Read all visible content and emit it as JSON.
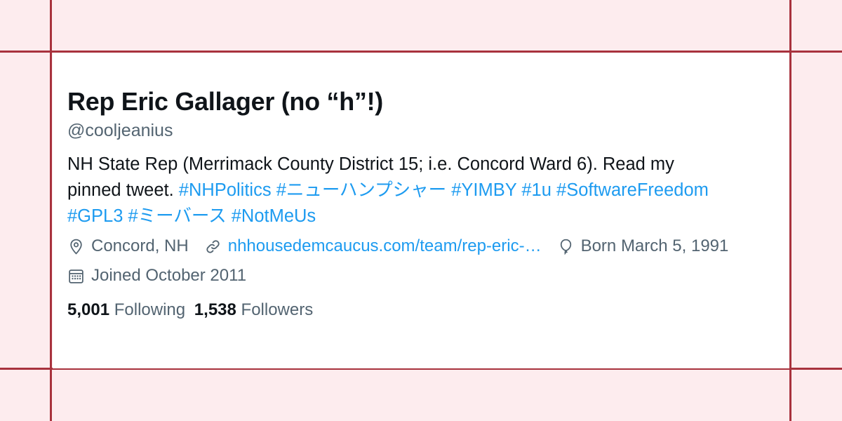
{
  "profile": {
    "display_name": "Rep Eric Gallager (no “h”!)",
    "handle": "@cooljeanius",
    "bio": {
      "line1": "NH State Rep (Merrimack County District 15; i.e. Concord Ward 6). Read my",
      "line2_text": "pinned tweet.",
      "line2_tags": [
        "#NHPolitics",
        "#ニューハンプシャー",
        "#YIMBY",
        "#1u",
        "#SoftwareFreedom"
      ],
      "line3_tags": [
        "#GPL3",
        "#ミーバース",
        "#NotMeUs"
      ]
    },
    "location": "Concord, NH",
    "website": "nhhousedemcaucus.com/team/rep-eric-…",
    "birthday": "Born March 5, 1991",
    "joined": "Joined October 2011",
    "following_count": "5,001",
    "following_label": "Following",
    "followers_count": "1,538",
    "followers_label": "Followers"
  },
  "colors": {
    "background": "#fdecee",
    "frame_lines": "#a8323d",
    "card": "#ffffff",
    "text_primary": "#0f1419",
    "text_secondary": "#536471",
    "link": "#1d9bf0"
  },
  "icons": {
    "location": "location-pin-icon",
    "website": "link-icon",
    "birthday": "balloon-icon",
    "joined": "calendar-icon"
  }
}
